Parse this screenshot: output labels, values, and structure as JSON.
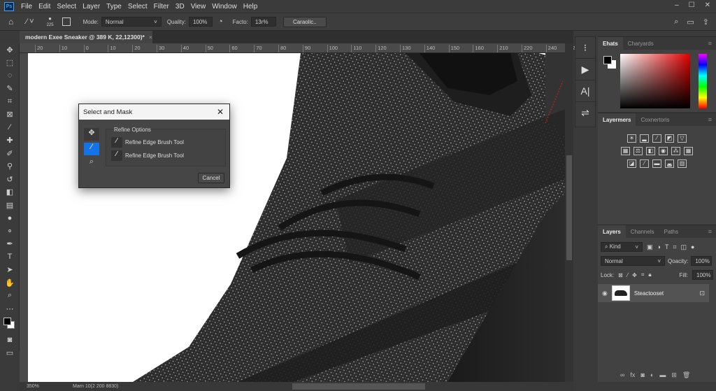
{
  "menubar": {
    "logo": "Ps",
    "items": [
      "File",
      "Edit",
      "Select",
      "Layer",
      "Type",
      "Select",
      "Filter",
      "3D",
      "View",
      "Window",
      "Help"
    ]
  },
  "options": {
    "brush_size": "225",
    "mode_label": "Mode:",
    "mode_value": "Normal",
    "quality_label": "Quality:",
    "quality_value": "100%",
    "factor_label": "Facto:",
    "factor_value": "13r%",
    "button": "Caraolic.."
  },
  "document": {
    "tab_title": "modern Exee Sneaker @ 389 K, 22,12300)*",
    "close": "×"
  },
  "ruler": {
    "ticks": [
      "20",
      "10",
      "0",
      "10",
      "20",
      "30",
      "40",
      "50",
      "60",
      "70",
      "80",
      "90",
      "100",
      "110",
      "120",
      "130",
      "140",
      "150",
      "160",
      "210",
      "220",
      "240",
      "260"
    ]
  },
  "status": {
    "zoom": "350%",
    "info": "Marn 10(2 200 8830)"
  },
  "dialog": {
    "title": "Select and Mask",
    "group_label": "Refine Options",
    "items": [
      "Refine Edge Brush Tool",
      "Refine Edge Brush Tool"
    ],
    "cancel": "Cancel"
  },
  "color_panel": {
    "tabs": [
      "Ehats",
      "Charyards"
    ],
    "foreground": "#000000",
    "background": "#ffffff",
    "hue": "#e00000"
  },
  "adjust_panel": {
    "tabs": [
      "Layermers",
      "Coxnertoris"
    ]
  },
  "layers_panel": {
    "tabs": [
      "Layers",
      "Channels",
      "Paths"
    ],
    "filter": "Kind",
    "blend_mode": "Normal",
    "opacity_label": "Qoacity:",
    "opacity": "100%",
    "lock_label": "Lock:",
    "fill_label": "Fill:",
    "fill": "100%",
    "layer_name": "Steactooset"
  },
  "colors": {
    "accent": "#1473e6",
    "ui_dark": "#3b3b3b"
  }
}
